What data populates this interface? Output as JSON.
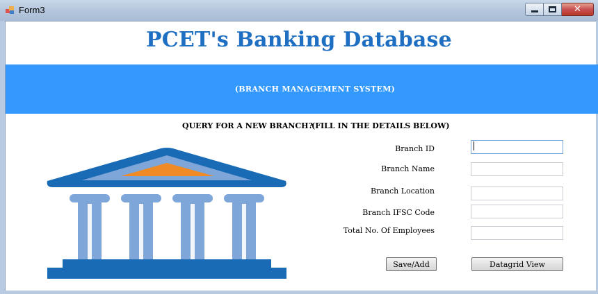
{
  "window": {
    "title": "Form3"
  },
  "header": {
    "title": "PCET's Banking Database",
    "subtitle": "(BRANCH MANAGEMENT SYSTEM)"
  },
  "query": {
    "title": "QUERY FOR A NEW BRANCH?",
    "hint": "(FILL IN THE DETAILS BELOW)"
  },
  "form": {
    "fields": [
      {
        "label": "Branch ID",
        "value": ""
      },
      {
        "label": "Branch Name",
        "value": ""
      },
      {
        "label": "Branch Location",
        "value": ""
      },
      {
        "label": "Branch IFSC Code",
        "value": ""
      },
      {
        "label": "Total No. Of Employees",
        "value": ""
      }
    ],
    "save_label": "Save/Add",
    "grid_label": "Datagrid View"
  },
  "colors": {
    "brand": "#1e6fc1",
    "banner": "#3399ff",
    "logo_dark": "#1a6bb5",
    "logo_light": "#7ea6d8",
    "logo_accent": "#f08a24"
  },
  "icons": {
    "app": "form-icon",
    "logo": "bank-building-icon"
  }
}
